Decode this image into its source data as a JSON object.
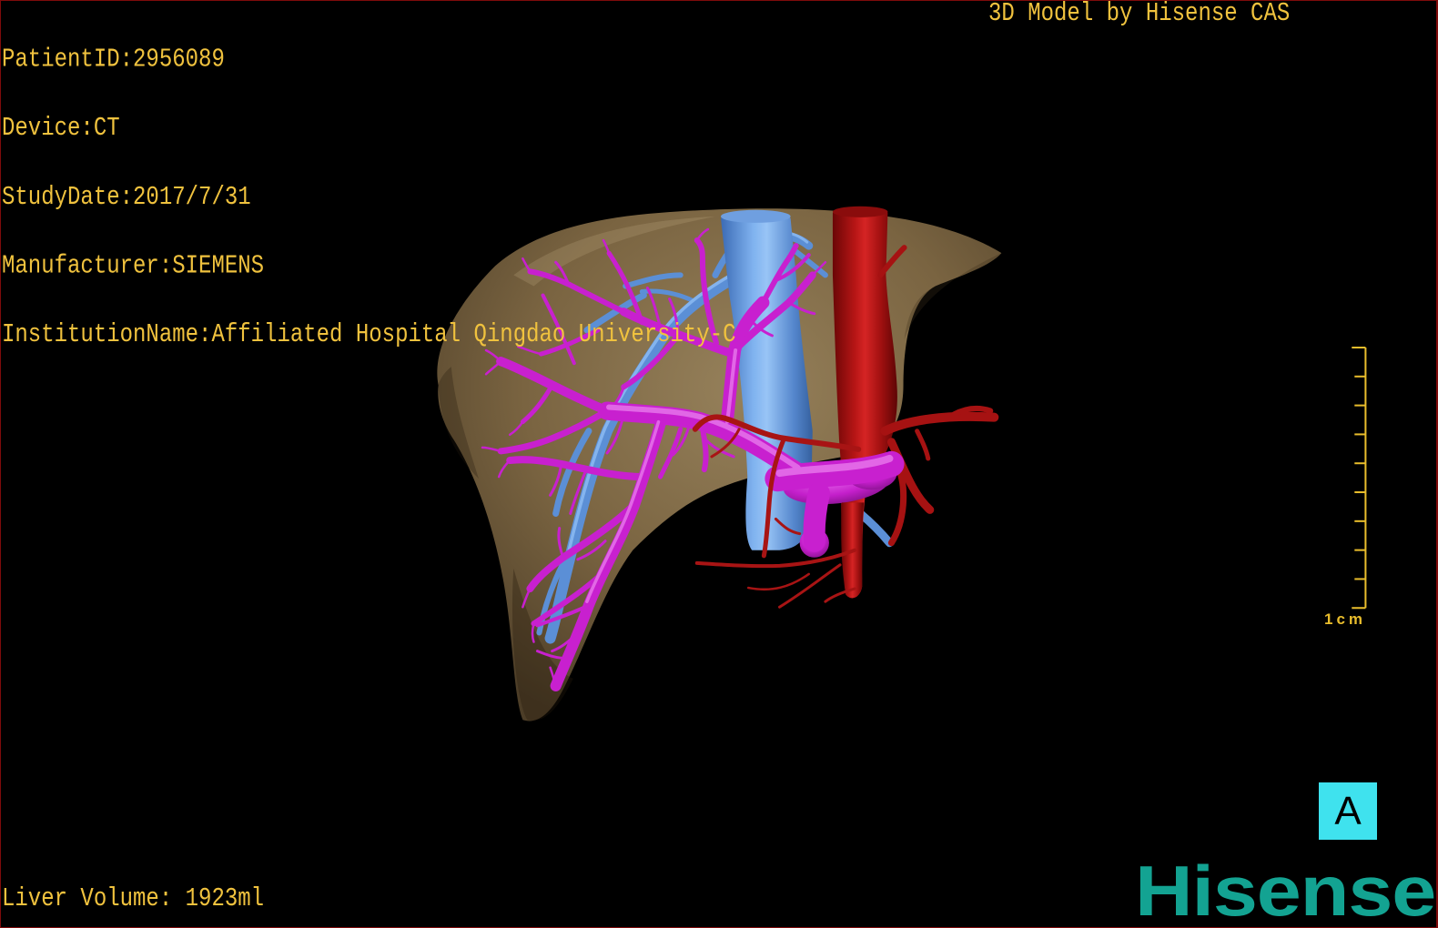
{
  "colors": {
    "background": "#000000",
    "frame": "#7f0b0b",
    "overlay_text": "#f0c23e",
    "scale_bar": "#e9bd2c",
    "orientation_cube": "#3fe2ee",
    "logo": "#13a392"
  },
  "patient_info": [
    {
      "label": "PatientID:",
      "value": "2956089"
    },
    {
      "label": "Device:",
      "value": "CT"
    },
    {
      "label": "StudyDate:",
      "value": "2017/7/31"
    },
    {
      "label": "Manufacturer:",
      "value": "SIEMENS"
    },
    {
      "label": "InstitutionName:",
      "value": "Affiliated Hospital Qingdao University-C"
    }
  ],
  "caption": "3D Model by Hisense CAS",
  "liver_volume": {
    "label": "Liver Volume:",
    "value": "1923ml"
  },
  "scale_bar": {
    "label": "1cm"
  },
  "orientation_cube": {
    "label": "A"
  },
  "logo": {
    "text": "Hisense"
  }
}
